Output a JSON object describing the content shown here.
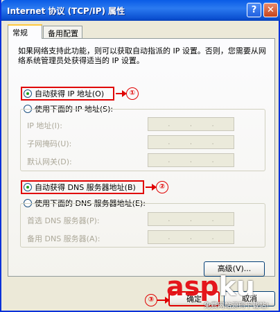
{
  "window": {
    "title": "Internet 协议 (TCP/IP) 属性",
    "help_label": "?",
    "close_label": "✕"
  },
  "tabs": [
    {
      "label": "常规",
      "active": true
    },
    {
      "label": "备用配置",
      "active": false
    }
  ],
  "description": "如果网络支持此功能，则可以获取自动指派的 IP 设置。否则，您需要从网络系统管理员处获得适当的 IP 设置。",
  "ip_section": {
    "auto_option": "自动获得 IP 地址(O)",
    "auto_checked": true,
    "manual_option": "使用下面的 IP 地址(S):",
    "manual_checked": false,
    "fields": [
      {
        "label": "IP 地址(I):"
      },
      {
        "label": "子网掩码(U):"
      },
      {
        "label": "默认网关(D):"
      }
    ]
  },
  "dns_section": {
    "auto_option": "自动获得 DNS 服务器地址(B)",
    "auto_checked": true,
    "manual_option": "使用下面的 DNS 服务器地址(E):",
    "manual_checked": false,
    "fields": [
      {
        "label": "首选 DNS 服务器(P):"
      },
      {
        "label": "备用 DNS 服务器(A):"
      }
    ]
  },
  "ip_dot": ".",
  "advanced_label": "高级(V)...",
  "footer": {
    "ok_label": "确定",
    "cancel_label": "取消"
  },
  "callouts": {
    "one": "①",
    "two": "②",
    "three": "③"
  },
  "watermark": {
    "main_a": "asp",
    "main_b": "ku",
    "sub": "免费网站源码下载站!"
  },
  "colors": {
    "highlight": "#e00000",
    "titlebar": "#0a5ce6",
    "radio_dot": "#21a121"
  }
}
